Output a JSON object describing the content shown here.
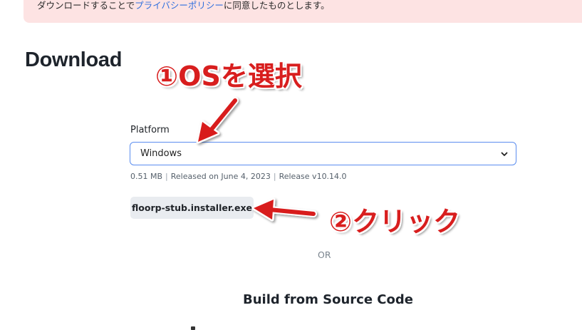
{
  "notice": {
    "prefix": "ダウンロードすることで",
    "link": "プライバシーポリシー",
    "suffix": "に同意したものとします。"
  },
  "page_title": "Download",
  "platform": {
    "label": "Platform",
    "selected": "Windows",
    "meta": {
      "size": "0.51 MB",
      "released": "Released on June 4, 2023",
      "release": "Release v10.14.0",
      "separator": "|"
    }
  },
  "download_button": {
    "label": "floorp-stub.installer.exe"
  },
  "or_label": "OR",
  "build_section": {
    "title": "Build from Source Code"
  },
  "annotations": {
    "step1": "①OSを選択",
    "step2": "②クリック",
    "color": "#d81e1e"
  },
  "colors": {
    "notice_bg": "#fde3e3",
    "link": "#2f6fde",
    "select_border": "#5b8def",
    "button_bg": "#e9ecf0"
  }
}
